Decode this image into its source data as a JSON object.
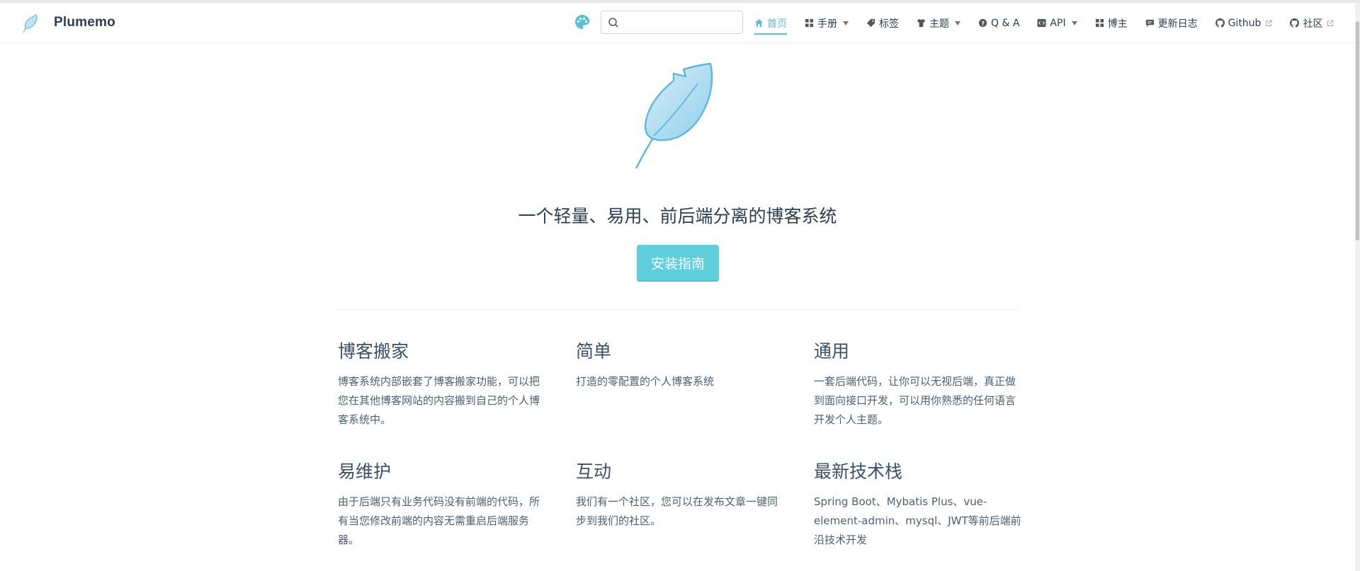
{
  "navbar": {
    "site_name": "Plumemo",
    "search": {
      "value": "",
      "placeholder": ""
    },
    "links": [
      {
        "label": "首页",
        "icon": "home-icon",
        "active": true,
        "dropdown": false,
        "external": false
      },
      {
        "label": "手册",
        "icon": "grid-icon",
        "active": false,
        "dropdown": true,
        "external": false
      },
      {
        "label": "标签",
        "icon": "tag-icon",
        "active": false,
        "dropdown": false,
        "external": false
      },
      {
        "label": "主题",
        "icon": "shirt-icon",
        "active": false,
        "dropdown": true,
        "external": false
      },
      {
        "label": "Q & A",
        "icon": "question-icon",
        "active": false,
        "dropdown": false,
        "external": false
      },
      {
        "label": "API",
        "icon": "code-icon",
        "active": false,
        "dropdown": true,
        "external": false
      },
      {
        "label": "博主",
        "icon": "grid-icon",
        "active": false,
        "dropdown": false,
        "external": false
      },
      {
        "label": "更新日志",
        "icon": "message-icon",
        "active": false,
        "dropdown": false,
        "external": false
      },
      {
        "label": "Github",
        "icon": "github-icon",
        "active": false,
        "dropdown": false,
        "external": true
      },
      {
        "label": "社区",
        "icon": "github-icon",
        "active": false,
        "dropdown": false,
        "external": true
      }
    ]
  },
  "hero": {
    "tagline": "一个轻量、易用、前后端分离的博客系统",
    "cta_label": "安装指南"
  },
  "features": [
    {
      "title": "博客搬家",
      "desc": "博客系统内部嵌套了博客搬家功能，可以把您在其他博客网站的内容搬到自己的个人博客系统中。"
    },
    {
      "title": "简单",
      "desc": "打造的零配置的个人博客系统"
    },
    {
      "title": "通用",
      "desc": "一套后端代码，让你可以无视后端，真正做到面向接口开发，可以用你熟悉的任何语言开发个人主题。"
    },
    {
      "title": "易维护",
      "desc": "由于后端只有业务代码没有前端的代码，所有当您修改前端的内容无需重启后端服务器。"
    },
    {
      "title": "互动",
      "desc": "我们有一个社区，您可以在发布文章一键同步到我们的社区。"
    },
    {
      "title": "最新技术栈",
      "desc": "Spring Boot、Mybatis Plus、vue-element-admin、mysql、JWT等前后端前沿技术开发"
    }
  ],
  "colors": {
    "accent": "#5bc0d3",
    "button": "#5ed0dc",
    "feather": "#5bb7dc"
  }
}
